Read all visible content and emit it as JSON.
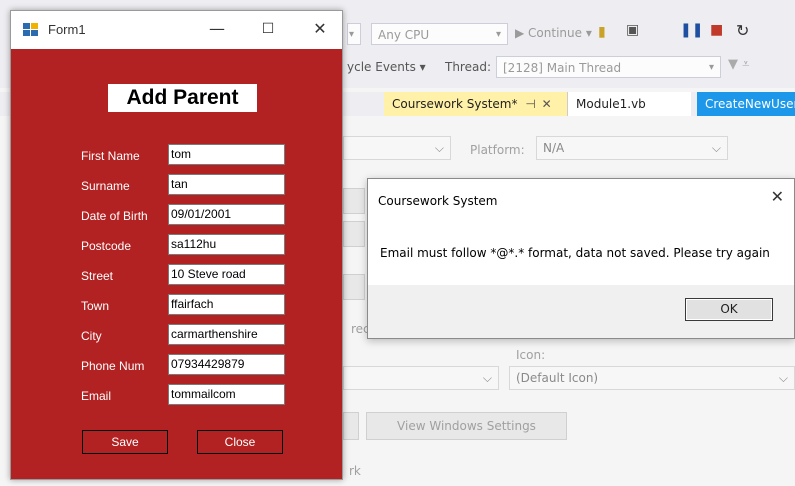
{
  "form": {
    "title": "Form1",
    "heading": "Add Parent",
    "fields": [
      {
        "label": "First Name",
        "value": "tom"
      },
      {
        "label": "Surname",
        "value": "tan"
      },
      {
        "label": "Date of Birth",
        "value": "09/01/2001"
      },
      {
        "label": "Postcode",
        "value": "sa112hu"
      },
      {
        "label": "Street",
        "value": "10 Steve road"
      },
      {
        "label": "Town",
        "value": "ffairfach"
      },
      {
        "label": "City",
        "value": "carmarthenshire"
      },
      {
        "label": "Phone Num",
        "value": "07934429879"
      },
      {
        "label": "Email",
        "value": "tommailcom"
      }
    ],
    "save_label": "Save",
    "close_label": "Close"
  },
  "dialog": {
    "title": "Coursework System",
    "message": "Email must follow *@*.* format, data not saved. Please try again",
    "ok_label": "OK"
  },
  "vs": {
    "cpu_combo": "Any CPU",
    "continue_label": "Continue",
    "lifecycle_label": "ycle Events",
    "thread_label": "Thread:",
    "thread_value": "[2128] Main Thread",
    "tabs": [
      "Coursework System*",
      "Module1.vb",
      "CreateNewUser"
    ],
    "platform_label": "Platform:",
    "platform_value": "N/A",
    "icon_label": "Icon:",
    "icon_value": "(Default Icon)",
    "view_windows_settings": "View Windows Settings",
    "partial_rec": "rec",
    "partial_rk": "rk"
  }
}
